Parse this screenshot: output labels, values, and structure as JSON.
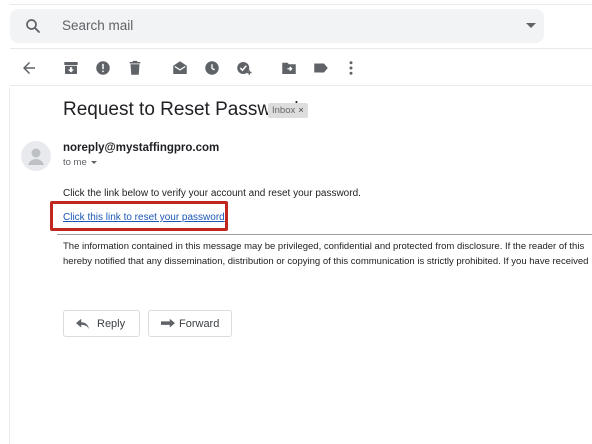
{
  "search": {
    "placeholder": "Search mail"
  },
  "toolbar": {
    "icons": [
      "back-arrow-icon",
      "archive-icon",
      "report-spam-icon",
      "delete-icon",
      "mark-unread-icon",
      "snooze-icon",
      "add-to-tasks-icon",
      "move-to-icon",
      "labels-icon",
      "more-options-icon"
    ]
  },
  "email": {
    "subject": "Request to Reset Password",
    "label_chip": "Inbox",
    "label_chip_close": "×",
    "sender": "noreply@mystaffingpro.com",
    "recipient_line": "to me",
    "body_line": "Click the link below to verify your account and reset your password.",
    "link_text": "Click this link to reset your password",
    "disclaimer_line1": "The information contained in this message may be privileged, confidential and protected from disclosure. If the reader of this",
    "disclaimer_line2": "hereby notified that any dissemination, distribution or copying of this communication is strictly prohibited. If you have received"
  },
  "actions": {
    "reply_label": "Reply",
    "forward_label": "Forward"
  },
  "colors": {
    "highlight_box": "#c0271f",
    "link": "#1a58b5",
    "search_bg": "#f1f3f4"
  }
}
